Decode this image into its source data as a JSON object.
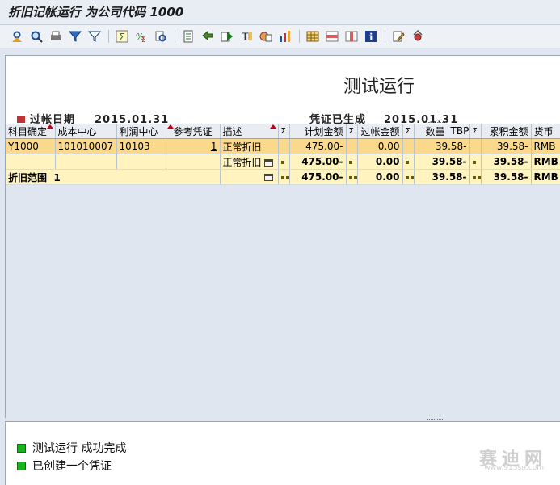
{
  "window": {
    "title": "折旧记帐运行 为公司代码 1000"
  },
  "toolbar": {
    "icons": [
      "select-detail-icon",
      "find-icon",
      "print-icon",
      "filter-icon",
      "funnel-icon",
      "sum-icon",
      "subtotal-icon",
      "magnify-icon",
      "export-icon",
      "back-arrow-icon",
      "choose-icon",
      "text-icon",
      "layout-icon",
      "chart-icon",
      "grid-icon",
      "grid-select-icon",
      "grid-change-icon",
      "info-icon",
      "edit-icon",
      "settings-icon"
    ]
  },
  "header": {
    "title": "测试运行",
    "cut_left_label": "过帐日期",
    "cut_left_value": "2015.01.31",
    "cut_right_label": "凭证已生成",
    "cut_right_value": "2015.01.31"
  },
  "table": {
    "columns": [
      "科目确定",
      "成本中心",
      "利润中心",
      "参考凭证",
      "描述",
      "Σ",
      "计划金额",
      "Σ",
      "过帐金额",
      "Σ",
      "数量",
      "TBP",
      "Σ",
      "累积金额",
      "货币"
    ],
    "rows": [
      {
        "account": "Y1000",
        "cost_center": "101010007",
        "profit_center": "10103",
        "ref_doc": "1",
        "desc": "正常折旧",
        "planned": "475.00-",
        "posted": "0.00",
        "qty": "39.58-",
        "cum": "39.58-",
        "currency": "RMB"
      },
      {
        "desc": "正常折旧",
        "planned": "475.00-",
        "posted": "0.00",
        "qty": "39.58-",
        "cum": "39.58-",
        "currency": "RMB"
      },
      {
        "label": "折旧范围",
        "value": "1",
        "planned": "475.00-",
        "posted": "0.00",
        "qty": "39.58-",
        "cum": "39.58-",
        "currency": "RMB"
      }
    ]
  },
  "messages": [
    {
      "text": "测试运行  成功完成",
      "status_color": "#19b31f"
    },
    {
      "text": "已创建一个凭证",
      "status_color": "#19b31f"
    }
  ],
  "watermark": {
    "text": "赛迪网",
    "url": "www.915sn.com"
  }
}
